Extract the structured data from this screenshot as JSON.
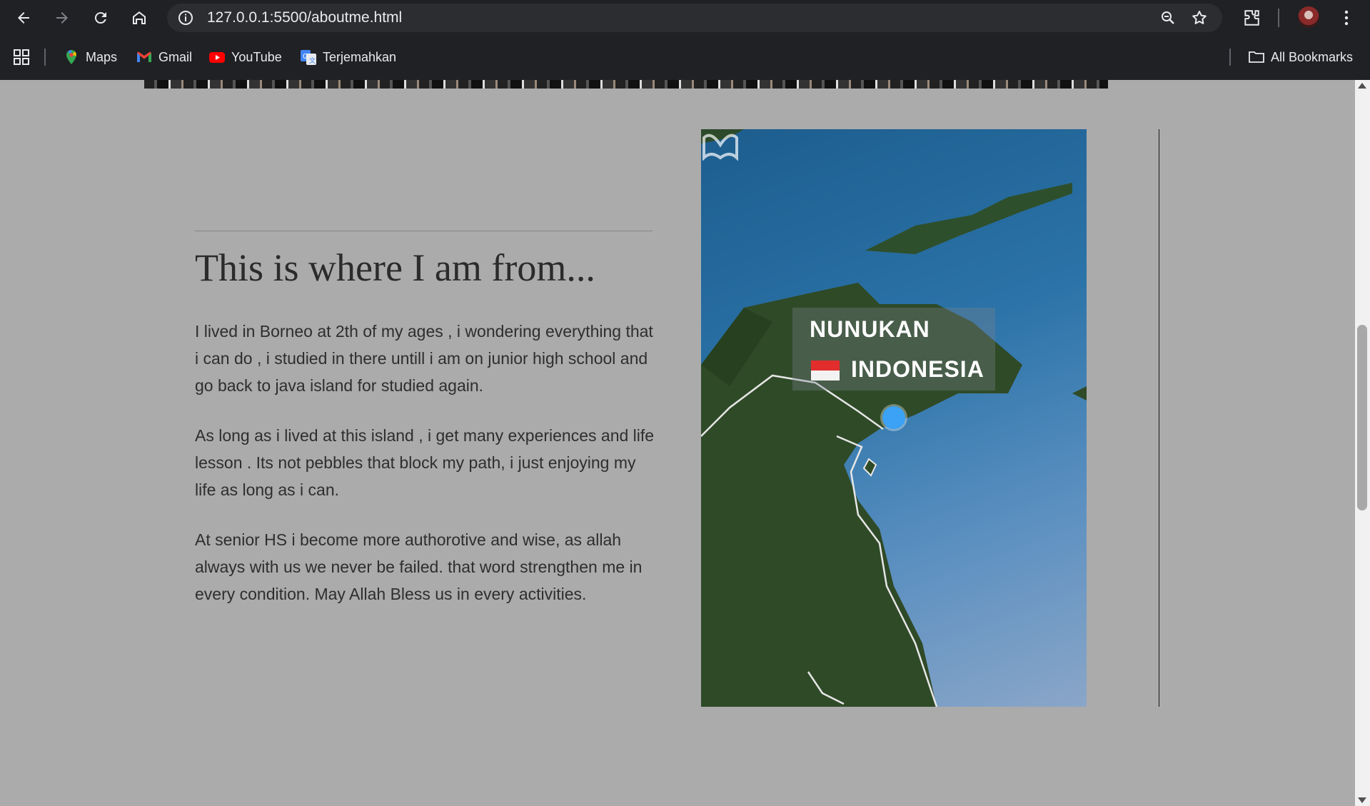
{
  "browser": {
    "url": "127.0.0.1:5500/aboutme.html",
    "bookmarks": [
      {
        "label": "Maps",
        "icon": "maps-icon"
      },
      {
        "label": "Gmail",
        "icon": "gmail-icon"
      },
      {
        "label": "YouTube",
        "icon": "youtube-icon"
      },
      {
        "label": "Terjemahkan",
        "icon": "translate-icon"
      }
    ],
    "all_bookmarks": "All Bookmarks"
  },
  "page": {
    "heading": "This is where I am from...",
    "paragraphs": [
      "I lived in Borneo at 2th of my ages , i wondering everything that i can do , i studied in there untill i am on junior high school and go back to java island for studied again.",
      "As long as i lived at this island , i get many experiences and life lesson . Its not pebbles that block my path, i just enjoying my life as long as i can.",
      "At senior HS i become more authorotive and wise, as allah always with us we never be failed. that word strengthen me in every condition. May Allah Bless us in every activities."
    ],
    "map": {
      "city": "NUNUKAN",
      "country": "INDONESIA"
    }
  },
  "colors": {
    "page_background": "#ababab",
    "chrome_background": "#202124",
    "pin": "#3ba2f5"
  }
}
